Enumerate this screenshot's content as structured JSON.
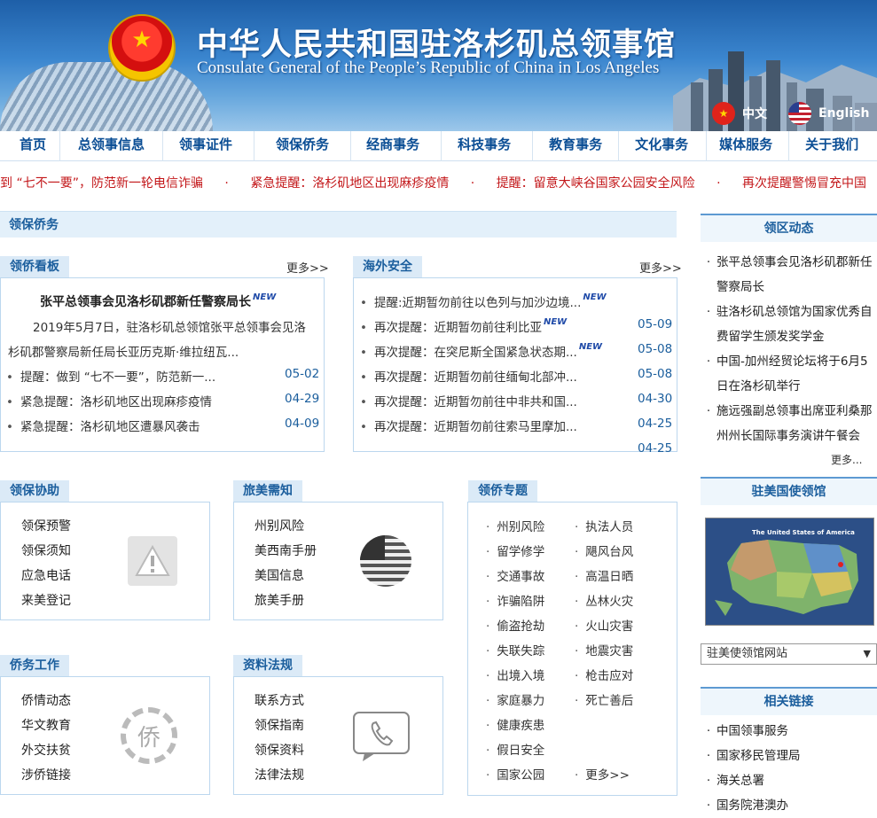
{
  "header": {
    "title_cn": "中华人民共和国驻洛杉矶总领事馆",
    "title_en": "Consulate General of the People’s Republic of China in Los  Angeles",
    "lang_cn": "中文",
    "lang_en": "English"
  },
  "nav": [
    "首页",
    "总领事信息",
    "领事证件",
    "领保侨务",
    "经商事务",
    "科技事务",
    "教育事务",
    "文化事务",
    "媒体服务",
    "关于我们"
  ],
  "marquee": [
    "到 “七不一要”，防范新一轮电信诈骗",
    "·",
    "紧急提醒：洛杉矶地区出现麻疹疫情",
    "·",
    "提醒：留意大峡谷国家公园安全风险",
    "·",
    "再次提醒警惕冒充中国"
  ],
  "section_title": "领保侨务",
  "lqkb": {
    "tab": "领侨看板",
    "more": "更多>>",
    "headline": "张平总领事会见洛杉矶郡新任警察局长",
    "new": "NEW",
    "summary_1": "2019年5月7日，驻洛杉矶总领馆张平总领事会见洛",
    "summary_2": "杉矶郡警察局新任局长亚历克斯·维拉纽瓦...",
    "items": [
      {
        "text": "提醒：做到 “七不一要”，防范新一...",
        "date": "05-02"
      },
      {
        "text": "紧急提醒：洛杉矶地区出现麻疹疫情",
        "date": "04-29"
      },
      {
        "text": "紧急提醒：洛杉矶地区遭暴风袭击",
        "date": "04-09"
      }
    ]
  },
  "hwaq": {
    "tab": "海外安全",
    "more": "更多>>",
    "items": [
      {
        "text": "提醒:近期暂勿前往以色列与加沙边境...",
        "new": "NEW",
        "date": ""
      },
      {
        "text": "再次提醒：近期暂勿前往利比亚",
        "new": "NEW",
        "date": "05-09"
      },
      {
        "text": "再次提醒：在突尼斯全国紧急状态期...",
        "new": "NEW",
        "date": "05-08"
      },
      {
        "text": "再次提醒：近期暂勿前往缅甸北部冲...",
        "new": "",
        "date": "05-08"
      },
      {
        "text": "再次提醒：近期暂勿前往中非共和国...",
        "new": "",
        "date": "04-30"
      },
      {
        "text": "再次提醒：近期暂勿前往索马里摩加...",
        "new": "",
        "date": "04-25"
      },
      {
        "text": "",
        "new": "",
        "date": "04-25"
      }
    ]
  },
  "lbxz": {
    "tab": "领保协助",
    "links": [
      "领保预警",
      "领保须知",
      "应急电话",
      "来美登记"
    ]
  },
  "lmxz": {
    "tab": "旅美需知",
    "links": [
      "州别风险",
      "美西南手册",
      "美国信息",
      "旅美手册"
    ]
  },
  "lqzt": {
    "tab": "领侨专题",
    "col1": [
      "州别风险",
      "留学修学",
      "交通事故",
      "诈骗陷阱",
      "偷盗抢劫",
      "失联失踪",
      "出境入境",
      "家庭暴力",
      "健康疾患",
      "假日安全",
      "国家公园"
    ],
    "col2": [
      "执法人员",
      "飓风台风",
      "高温日晒",
      "丛林火灾",
      "火山灾害",
      "地震灾害",
      "枪击应对",
      "死亡善后"
    ],
    "more": "更多>>"
  },
  "qwgz": {
    "tab": "侨务工作",
    "links": [
      "侨情动态",
      "华文教育",
      "外交扶贫",
      "涉侨链接"
    ],
    "emblem_char": "侨"
  },
  "zlfg": {
    "tab": "资料法规",
    "links": [
      "联系方式",
      "领保指南",
      "领保资料",
      "法律法规"
    ]
  },
  "sidebar": {
    "lqdt_title": "领区动态",
    "lqdt_items": [
      "张平总领事会见洛杉矶郡新任警察局长",
      "驻洛杉矶总领馆为国家优秀自费留学生颁发奖学金",
      "中国-加州经贸论坛将于6月5日在洛杉矶举行",
      "施远强副总领事出席亚利桑那州州长国际事务演讲午餐会"
    ],
    "lqdt_more": "更多...",
    "embassy_title": "驻美国使领馆",
    "map_title": "The United States of America",
    "select_value": "驻美使领馆网站",
    "links_title": "相关链接",
    "links": [
      "中国领事服务",
      "国家移民管理局",
      "海关总署",
      "国务院港澳办"
    ]
  },
  "colors": {
    "nav_text": "#0a4d94",
    "marquee": "#c3171a",
    "accent": "#1b5e9d",
    "date": "#1b5e9d"
  }
}
